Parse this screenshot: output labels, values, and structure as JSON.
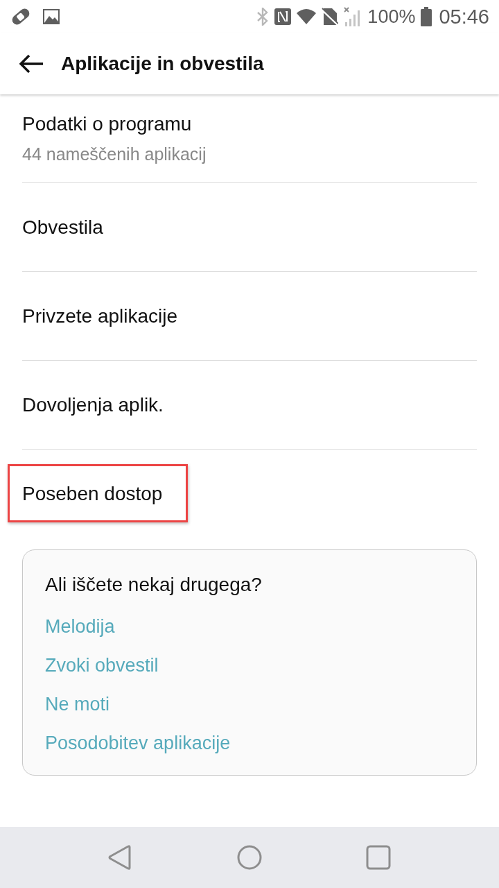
{
  "status_bar": {
    "battery_text": "100%",
    "time": "05:46"
  },
  "app_bar": {
    "title": "Aplikacije in obvestila"
  },
  "items": [
    {
      "title": "Podatki o programu",
      "subtitle": "44 nameščenih aplikacij",
      "highlighted": false
    },
    {
      "title": "Obvestila",
      "highlighted": false
    },
    {
      "title": "Privzete aplikacije",
      "highlighted": false
    },
    {
      "title": "Dovoljenja aplik.",
      "highlighted": false
    },
    {
      "title": "Poseben dostop",
      "highlighted": true
    }
  ],
  "suggestions": {
    "heading": "Ali iščete nekaj drugega?",
    "links": [
      "Melodija",
      "Zvoki obvestil",
      "Ne moti",
      "Posodobitev aplikacije"
    ]
  }
}
